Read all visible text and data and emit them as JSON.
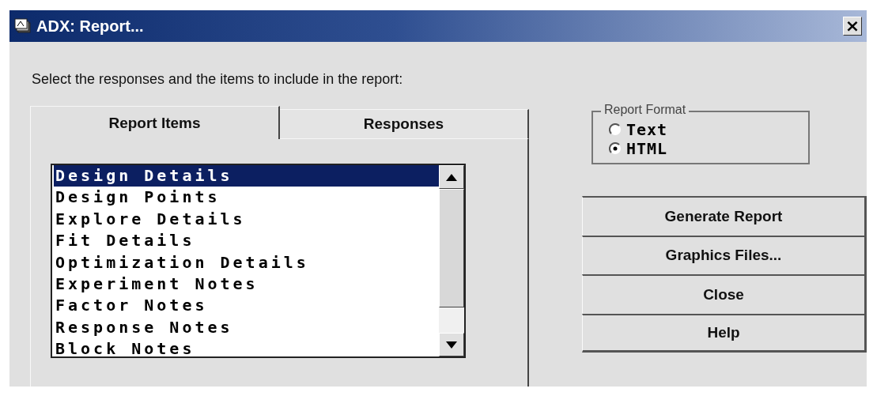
{
  "window": {
    "title": "ADX: Report...",
    "close": "×"
  },
  "instruction": "Select the responses and the items to include in the report:",
  "tabs": [
    {
      "label": "Report Items",
      "selected": true
    },
    {
      "label": "Responses",
      "selected": false
    }
  ],
  "list": {
    "items": [
      {
        "label": "Design Details",
        "selected": true
      },
      {
        "label": "Design Points",
        "selected": false
      },
      {
        "label": "Explore Details",
        "selected": false
      },
      {
        "label": "Fit Details",
        "selected": false
      },
      {
        "label": "Optimization Details",
        "selected": false
      },
      {
        "label": "Experiment Notes",
        "selected": false
      },
      {
        "label": "Factor Notes",
        "selected": false
      },
      {
        "label": "Response Notes",
        "selected": false
      },
      {
        "label": "Block Notes",
        "selected": false
      }
    ]
  },
  "report_format": {
    "title": "Report Format",
    "options": [
      {
        "label": "Text",
        "selected": false
      },
      {
        "label": "HTML",
        "selected": true
      }
    ]
  },
  "buttons": [
    "Generate Report",
    "Graphics Files...",
    "Close",
    "Help"
  ]
}
